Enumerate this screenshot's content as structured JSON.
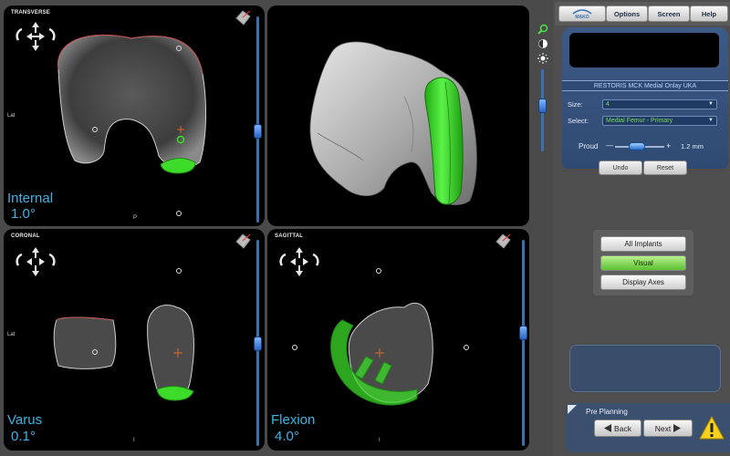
{
  "viewports": {
    "transverse": {
      "label": "TRANSVERSE",
      "lat": "Lat",
      "p": "P",
      "angle_name": "Internal",
      "angle_value": "1.0°"
    },
    "coronal": {
      "label": "CORONAL",
      "lat": "Lat",
      "i": "I",
      "angle_name": "Varus",
      "angle_value": "0.1°"
    },
    "sagittal": {
      "label": "SAGITTAL",
      "i": "I",
      "angle_name": "Flexion",
      "angle_value": "4.0°"
    }
  },
  "menu": {
    "logo": "MAKO",
    "options": "Options",
    "screen": "Screen",
    "help": "Help"
  },
  "planning": {
    "implant_title": "RESTORIS MCK Medial Onlay UKA",
    "size_label": "Size:",
    "size_value": "4",
    "select_label": "Select:",
    "select_value": "Medial Femur - Primary",
    "proud_label": "Proud",
    "proud_minus": "—",
    "proud_plus": "+",
    "proud_value": "1.2 mm",
    "proud_level": 0.45,
    "undo": "Undo",
    "reset": "Reset"
  },
  "view_buttons": {
    "all_implants": "All Implants",
    "visual": "Visual",
    "display_axes": "Display Axes"
  },
  "footer": {
    "title": "Pre Planning",
    "back": "Back",
    "next": "Next"
  },
  "colors": {
    "implant_green": "#3ddc2a",
    "angle_text": "#3fb3e6",
    "panel_blue": "#2f4a72"
  }
}
